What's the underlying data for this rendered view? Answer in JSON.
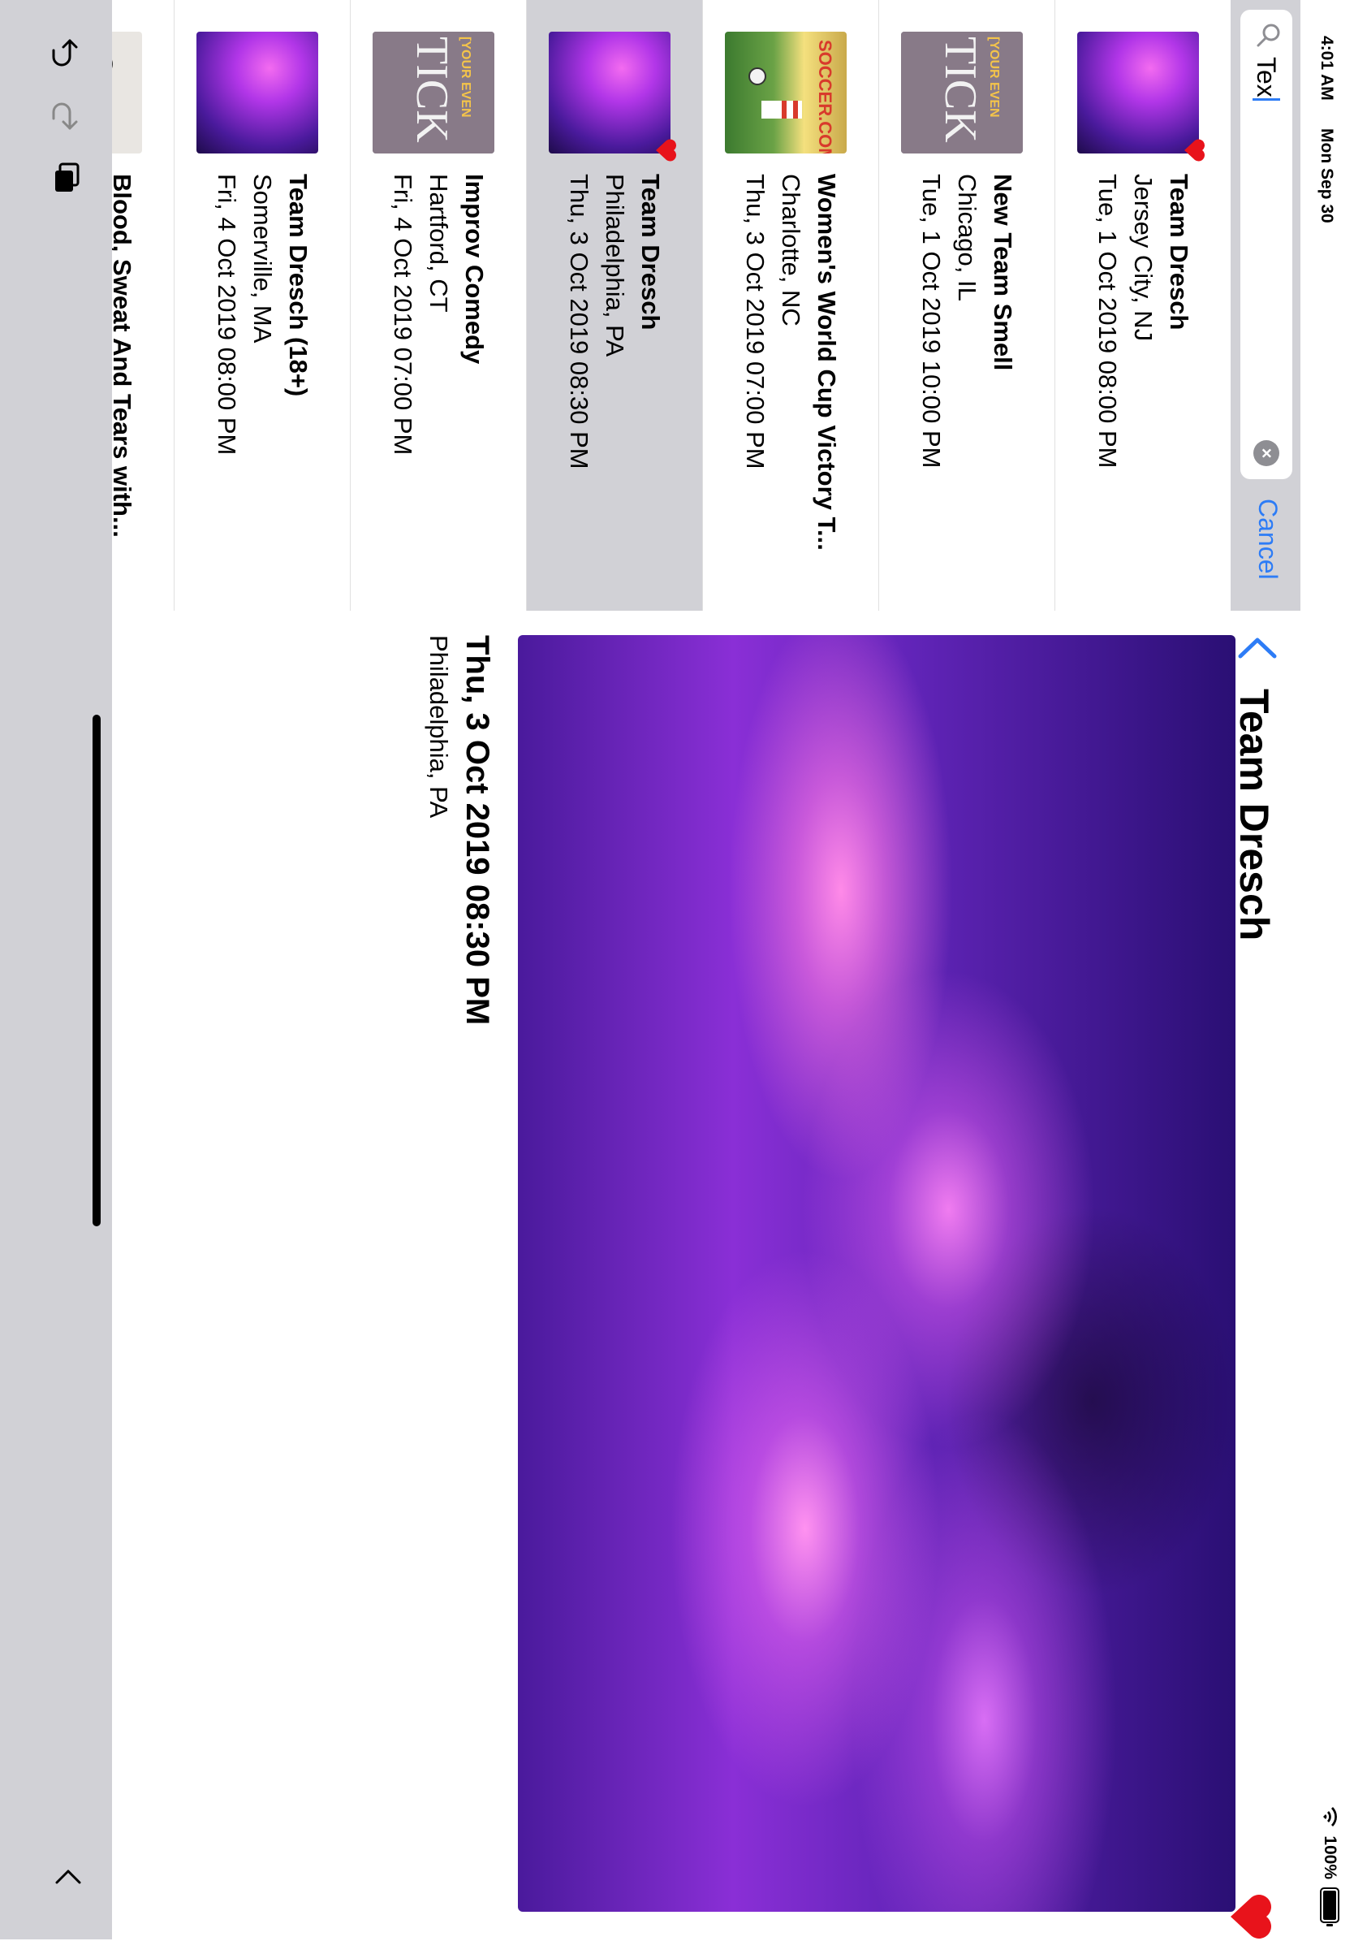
{
  "status": {
    "time": "4:01 AM",
    "date": "Mon Sep 30",
    "battery": "100%"
  },
  "search": {
    "query": "Tex",
    "cancel_label": "Cancel"
  },
  "events": [
    {
      "title": "Team Dresch",
      "place": "Jersey City, NJ",
      "when": "Tue, 1 Oct 2019 08:00 PM",
      "thumb": "concert-thumbnail",
      "favorite": true,
      "selected": false
    },
    {
      "title": "New Team Smell",
      "place": "Chicago, IL",
      "when": "Tue, 1 Oct 2019 10:00 PM",
      "thumb": "ticket-thumbnail",
      "favorite": false,
      "selected": false
    },
    {
      "title": "Women's World Cup Victory T...",
      "place": "Charlotte, NC",
      "when": "Thu, 3 Oct 2019 07:00 PM",
      "thumb": "soccer-thumbnail",
      "favorite": false,
      "selected": false
    },
    {
      "title": "Team Dresch",
      "place": "Philadelphia, PA",
      "when": "Thu, 3 Oct 2019 08:30 PM",
      "thumb": "concert-thumbnail",
      "favorite": true,
      "selected": true
    },
    {
      "title": "Improv Comedy",
      "place": "Hartford, CT",
      "when": "Fri, 4 Oct 2019 07:00 PM",
      "thumb": "ticket-thumbnail",
      "favorite": false,
      "selected": false
    },
    {
      "title": "Team Dresch (18+)",
      "place": "Somerville, MA",
      "when": "Fri, 4 Oct 2019 08:00 PM",
      "thumb": "concert-thumbnail",
      "favorite": false,
      "selected": false
    },
    {
      "title": "Blood, Sweat And Tears with...",
      "place": "",
      "when": "",
      "thumb": "portrait-thumbnail",
      "favorite": false,
      "selected": false
    }
  ],
  "ticket_thumb_text": {
    "top": "[YOUR EVEN",
    "big": "TICK"
  },
  "soccer_thumb_text": "SOCCER.COM",
  "detail": {
    "title": "Team Dresch",
    "date": "Thu, 3 Oct 2019 08:30 PM",
    "place": "Philadelphia, PA",
    "favorite": true
  },
  "colors": {
    "accent": "#2D7CF6",
    "favorite": "#E8131B",
    "selected_row": "#D1D1D6"
  }
}
